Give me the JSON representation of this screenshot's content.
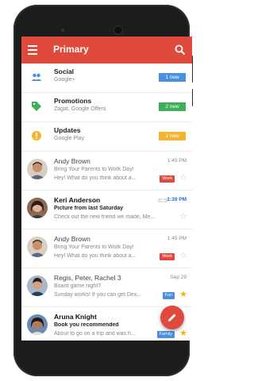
{
  "appbar": {
    "title": "Primary"
  },
  "categories": [
    {
      "title": "Social",
      "subtitle": "Google+",
      "badge": "1 new",
      "badge_color": "#4a8fe0",
      "icon": "people-icon",
      "icon_color": "#4a8fe0"
    },
    {
      "title": "Promotions",
      "subtitle": "Zagat, Google Offers",
      "badge": "2 new",
      "badge_color": "#3fae5a",
      "icon": "tag-icon",
      "icon_color": "#3fae5a"
    },
    {
      "title": "Updates",
      "subtitle": "Google Play",
      "badge": "1 new",
      "badge_color": "#f2b532",
      "icon": "info-icon",
      "icon_color": "#f2b532"
    }
  ],
  "mails": [
    {
      "from": "Andy Brown",
      "time": "1:45 PM",
      "subject": "Bring Your Parents to Work Day!",
      "snippet": "Hey! What do you think about a...",
      "label": "Work",
      "label_color": "#e04a3c",
      "starred": false,
      "unread": false
    },
    {
      "from": "Keri Anderson",
      "time": "1:39 PM",
      "subject": "Picture from last Saturday",
      "snippet": "Check out the new friend we made, Me...",
      "label": "",
      "starred": false,
      "unread": true
    },
    {
      "from": "Andy Brown",
      "time": "1:45 PM",
      "subject": "Bring Your Parents to Work Day!",
      "snippet": "Hey! What do you think about a...",
      "label": "Work",
      "label_color": "#e04a3c",
      "starred": false,
      "unread": false
    },
    {
      "from": "Regis, Peter, Rachel  3",
      "time": "Sep 29",
      "subject": "Board game night?",
      "snippet": "Sunday works! If you can get Dex...",
      "label": "Fun",
      "label_color": "#4a8fe0",
      "starred": true,
      "unread": false
    },
    {
      "from": "Aruna Knight",
      "time": "",
      "subject": "Book you recommended",
      "snippet": "About to go on a trip and was h...",
      "label": "Family",
      "label_color": "#4a8fe0",
      "starred": true,
      "unread": true
    }
  ],
  "colors": {
    "primary": "#e04a3c",
    "star": "#f6b400"
  }
}
